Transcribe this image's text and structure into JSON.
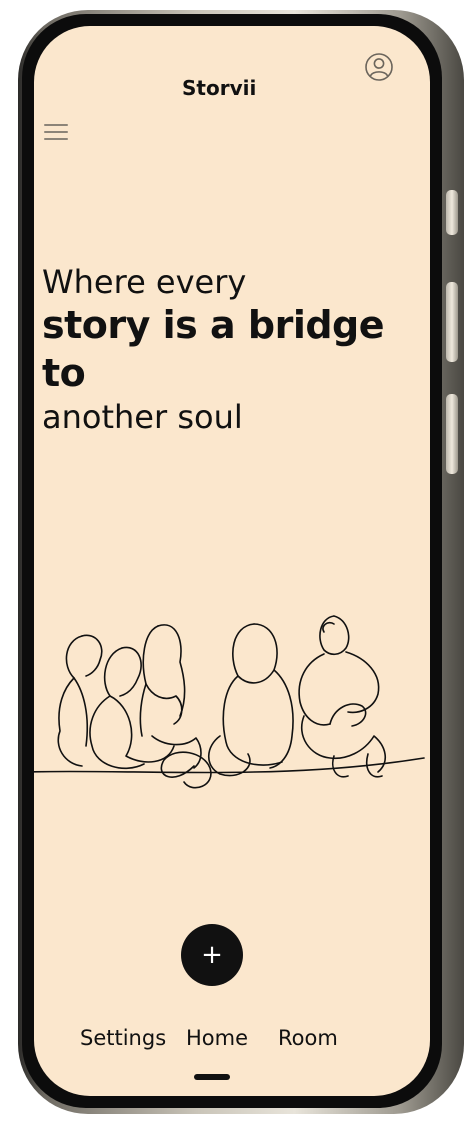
{
  "app": {
    "brand": "Storvii"
  },
  "hero": {
    "line1": "Where every",
    "line2": "story is a bridge to",
    "line3": "another soul"
  },
  "fab": {
    "label": "+"
  },
  "nav": {
    "settings": "Settings",
    "home": "Home",
    "room": "Room"
  },
  "colors": {
    "screen_bg": "#fbe7cd",
    "ink": "#111111"
  },
  "icons": {
    "menu": "hamburger-icon",
    "profile": "user-circle-icon"
  }
}
